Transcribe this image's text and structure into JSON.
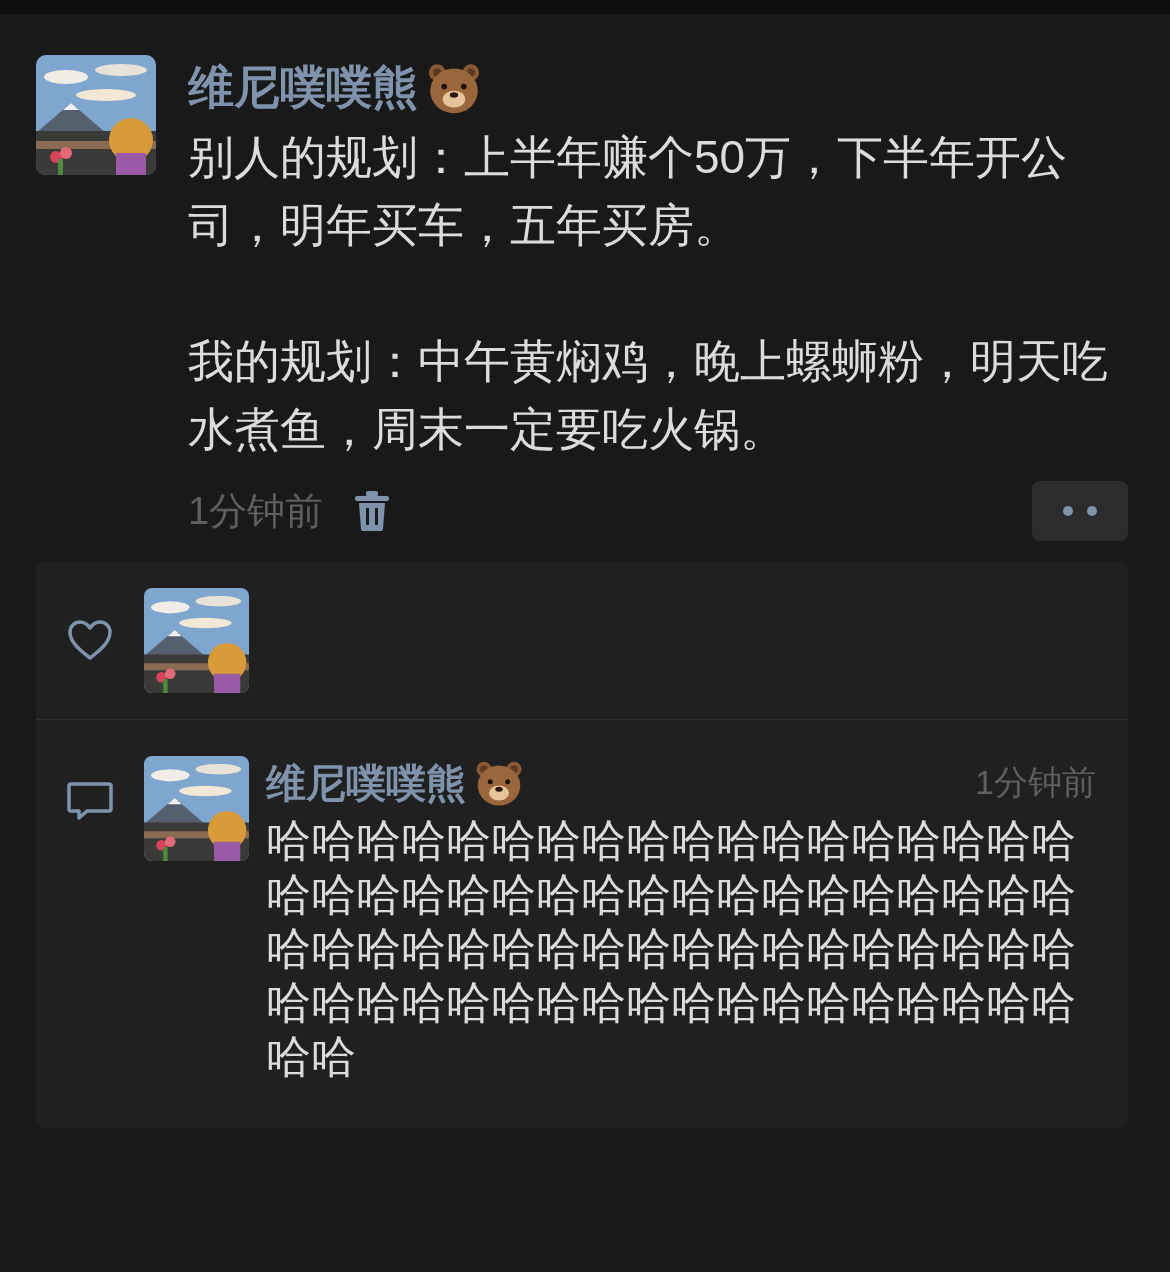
{
  "post": {
    "author": "维尼噗噗熊",
    "paragraphs": [
      "别人的规划：上半年赚个50万，下半年开公司，明年买车，五年买房。",
      "我的规划：中午黄焖鸡，晚上螺蛳粉，明天吃水煮鱼，周末一定要吃火锅。"
    ],
    "time": "1分钟前"
  },
  "comments": [
    {
      "author": "维尼噗噗熊",
      "time": "1分钟前",
      "text": "哈哈哈哈哈哈哈哈哈哈哈哈哈哈哈哈哈哈哈哈哈哈哈哈哈哈哈哈哈哈哈哈哈哈哈哈哈哈哈哈哈哈哈哈哈哈哈哈哈哈哈哈哈哈哈哈哈哈哈哈哈哈哈哈哈哈哈哈哈哈哈哈哈哈"
    }
  ]
}
